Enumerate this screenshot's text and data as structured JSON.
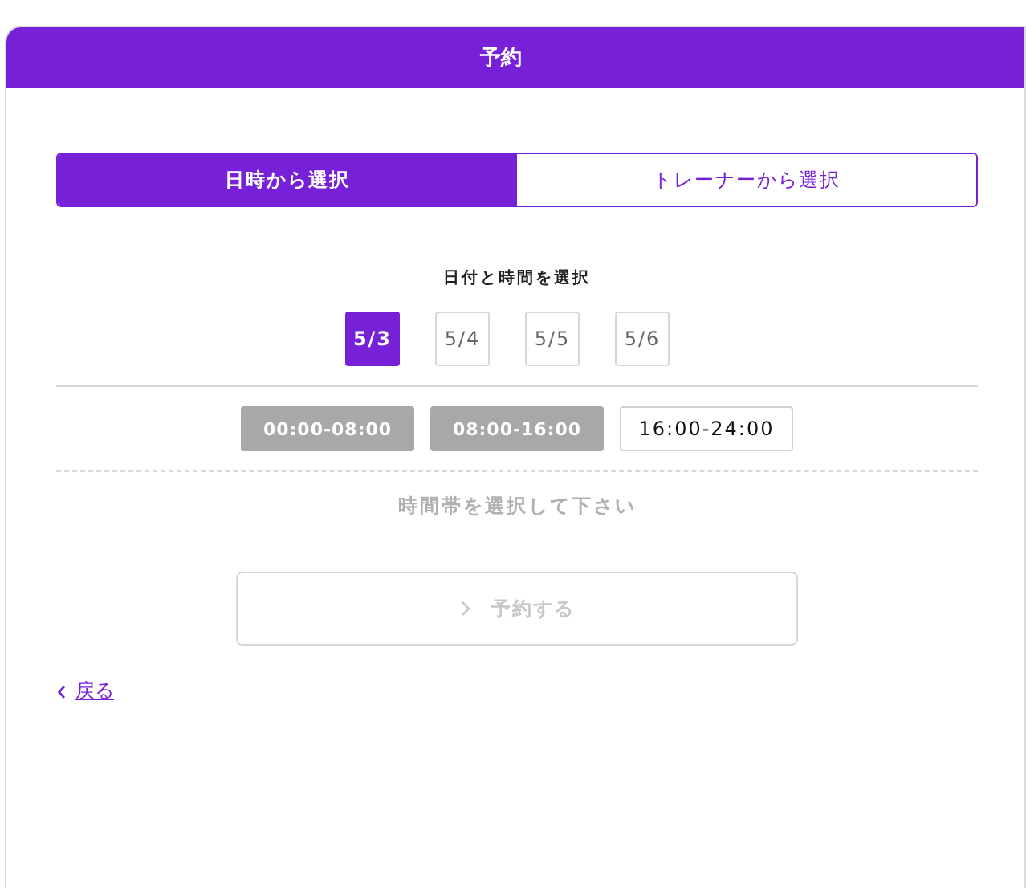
{
  "window": {
    "title": "予約"
  },
  "tabs": [
    {
      "label": "日時から選択",
      "selected": true
    },
    {
      "label": "トレーナーから選択",
      "selected": false
    }
  ],
  "section_label": "日付と時間を選択",
  "dates": [
    {
      "label": "5/3",
      "selected": true
    },
    {
      "label": "5/4",
      "selected": false
    },
    {
      "label": "5/5",
      "selected": false
    },
    {
      "label": "5/6",
      "selected": false
    }
  ],
  "time_slots": [
    {
      "label": "00:00-08:00",
      "disabled": true
    },
    {
      "label": "08:00-16:00",
      "disabled": true
    },
    {
      "label": "16:00-24:00",
      "disabled": false
    }
  ],
  "message": "時間帯を選択して下さい",
  "reserve_button": {
    "label": "予約する",
    "disabled": true
  },
  "back_link": "戻る"
}
